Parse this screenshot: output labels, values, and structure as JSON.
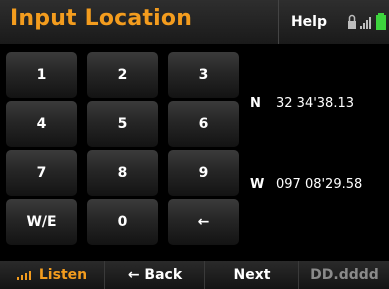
{
  "header": {
    "title": "Input Location",
    "help_label": "Help",
    "status_icons": [
      "lock-icon",
      "signal-bars-icon",
      "battery-icon"
    ]
  },
  "keypad": {
    "keys": [
      "1",
      "2",
      "3",
      "4",
      "5",
      "6",
      "7",
      "8",
      "9",
      "W/E",
      "0",
      "←"
    ]
  },
  "coordinates": {
    "lat_hemisphere": "N",
    "lat_value": "32 34'38.13",
    "lon_hemisphere": "W",
    "lon_value": "097 08'29.58"
  },
  "bottom_bar": {
    "listen_label": "Listen",
    "back_label": "← Back",
    "next_label": "Next",
    "format_label": "DD.dddd"
  },
  "colors": {
    "accent": "#f39c1e",
    "background": "#000000",
    "disabled_text": "#8a8a8a"
  }
}
